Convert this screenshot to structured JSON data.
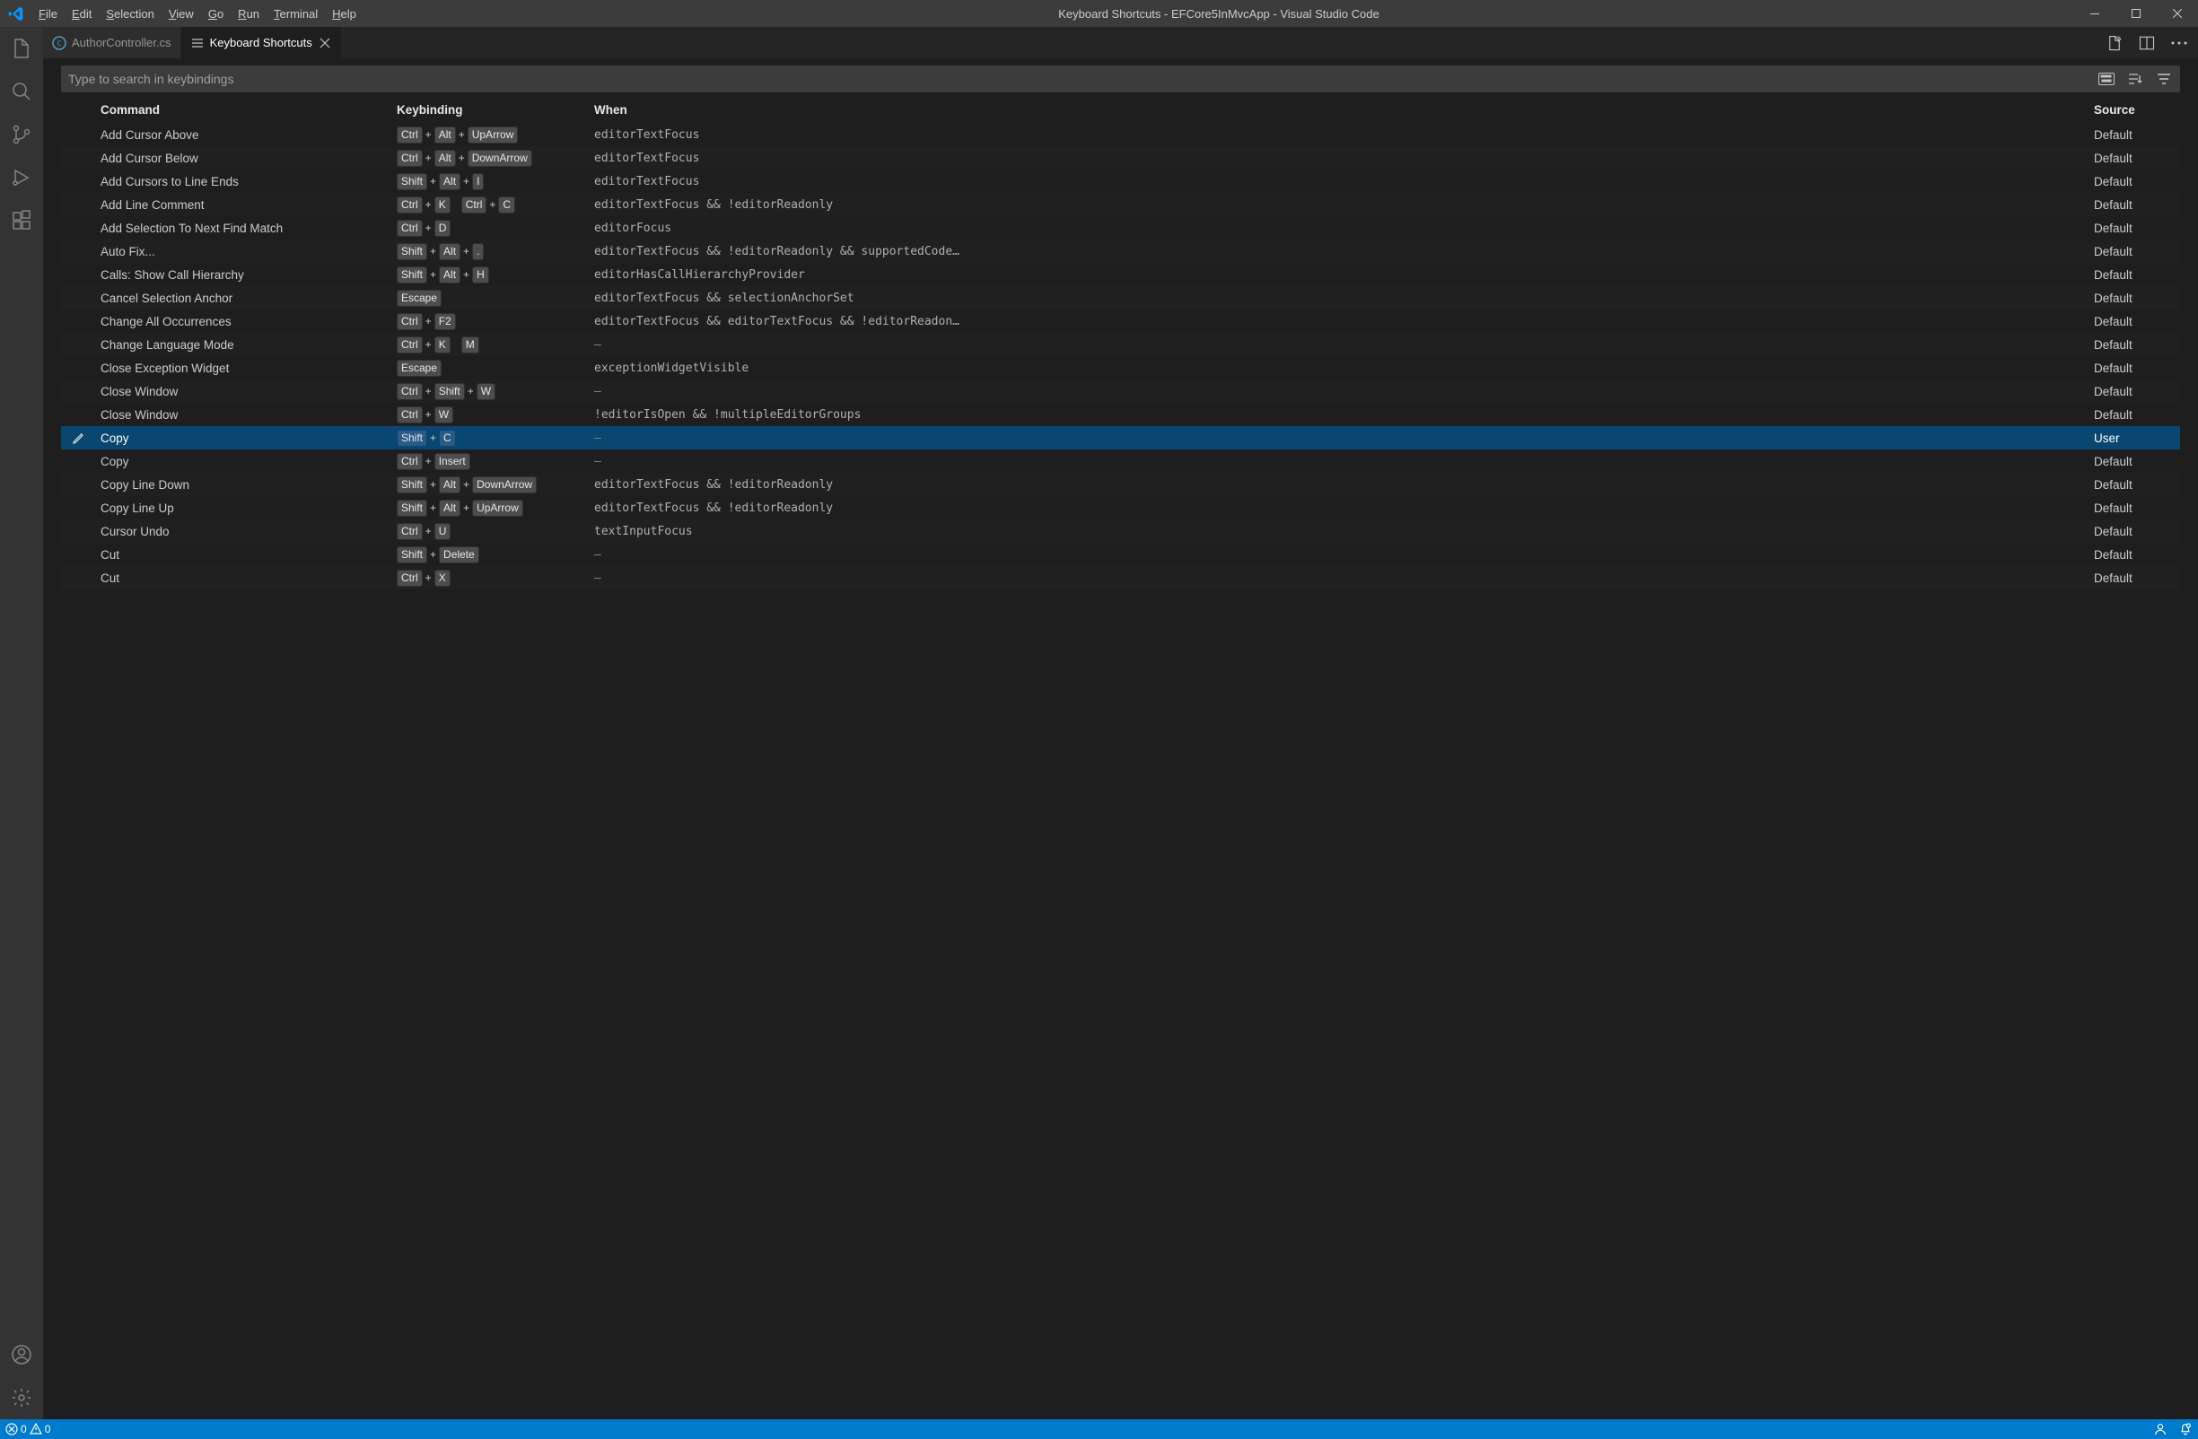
{
  "title": "Keyboard Shortcuts - EFCore5InMvcApp - Visual Studio Code",
  "menu": {
    "file": "File",
    "edit": "Edit",
    "selection": "Selection",
    "view": "View",
    "go": "Go",
    "run": "Run",
    "terminal": "Terminal",
    "help": "Help"
  },
  "tabs": {
    "inactive": {
      "label": "AuthorController.cs"
    },
    "active": {
      "label": "Keyboard Shortcuts"
    }
  },
  "search": {
    "placeholder": "Type to search in keybindings"
  },
  "headers": {
    "command": "Command",
    "keybinding": "Keybinding",
    "when": "When",
    "source": "Source"
  },
  "rows": [
    {
      "command": "Add Cursor Above",
      "keys": [
        "Ctrl",
        "+",
        "Alt",
        "+",
        "UpArrow"
      ],
      "when": "editorTextFocus",
      "source": "Default",
      "selected": false
    },
    {
      "command": "Add Cursor Below",
      "keys": [
        "Ctrl",
        "+",
        "Alt",
        "+",
        "DownArrow"
      ],
      "when": "editorTextFocus",
      "source": "Default",
      "selected": false
    },
    {
      "command": "Add Cursors to Line Ends",
      "keys": [
        "Shift",
        "+",
        "Alt",
        "+",
        "I"
      ],
      "when": "editorTextFocus",
      "source": "Default",
      "selected": false
    },
    {
      "command": "Add Line Comment",
      "keys": [
        "Ctrl",
        "+",
        "K",
        " ",
        "Ctrl",
        "+",
        "C"
      ],
      "when": "editorTextFocus && !editorReadonly",
      "source": "Default",
      "selected": false
    },
    {
      "command": "Add Selection To Next Find Match",
      "keys": [
        "Ctrl",
        "+",
        "D"
      ],
      "when": "editorFocus",
      "source": "Default",
      "selected": false
    },
    {
      "command": "Auto Fix...",
      "keys": [
        "Shift",
        "+",
        "Alt",
        "+",
        "."
      ],
      "when": "editorTextFocus && !editorReadonly && supportedCode…",
      "source": "Default",
      "selected": false
    },
    {
      "command": "Calls: Show Call Hierarchy",
      "keys": [
        "Shift",
        "+",
        "Alt",
        "+",
        "H"
      ],
      "when": "editorHasCallHierarchyProvider",
      "source": "Default",
      "selected": false
    },
    {
      "command": "Cancel Selection Anchor",
      "keys": [
        "Escape"
      ],
      "when": "editorTextFocus && selectionAnchorSet",
      "source": "Default",
      "selected": false
    },
    {
      "command": "Change All Occurrences",
      "keys": [
        "Ctrl",
        "+",
        "F2"
      ],
      "when": "editorTextFocus && editorTextFocus && !editorReadon…",
      "source": "Default",
      "selected": false
    },
    {
      "command": "Change Language Mode",
      "keys": [
        "Ctrl",
        "+",
        "K",
        " ",
        "M"
      ],
      "when": "—",
      "source": "Default",
      "selected": false
    },
    {
      "command": "Close Exception Widget",
      "keys": [
        "Escape"
      ],
      "when": "exceptionWidgetVisible",
      "source": "Default",
      "selected": false
    },
    {
      "command": "Close Window",
      "keys": [
        "Ctrl",
        "+",
        "Shift",
        "+",
        "W"
      ],
      "when": "—",
      "source": "Default",
      "selected": false
    },
    {
      "command": "Close Window",
      "keys": [
        "Ctrl",
        "+",
        "W"
      ],
      "when": "!editorIsOpen && !multipleEditorGroups",
      "source": "Default",
      "selected": false
    },
    {
      "command": "Copy",
      "keys": [
        "Shift",
        "+",
        "C"
      ],
      "when": "—",
      "source": "User",
      "selected": true
    },
    {
      "command": "Copy",
      "keys": [
        "Ctrl",
        "+",
        "Insert"
      ],
      "when": "—",
      "source": "Default",
      "selected": false
    },
    {
      "command": "Copy Line Down",
      "keys": [
        "Shift",
        "+",
        "Alt",
        "+",
        "DownArrow"
      ],
      "when": "editorTextFocus && !editorReadonly",
      "source": "Default",
      "selected": false
    },
    {
      "command": "Copy Line Up",
      "keys": [
        "Shift",
        "+",
        "Alt",
        "+",
        "UpArrow"
      ],
      "when": "editorTextFocus && !editorReadonly",
      "source": "Default",
      "selected": false
    },
    {
      "command": "Cursor Undo",
      "keys": [
        "Ctrl",
        "+",
        "U"
      ],
      "when": "textInputFocus",
      "source": "Default",
      "selected": false
    },
    {
      "command": "Cut",
      "keys": [
        "Shift",
        "+",
        "Delete"
      ],
      "when": "—",
      "source": "Default",
      "selected": false
    },
    {
      "command": "Cut",
      "keys": [
        "Ctrl",
        "+",
        "X"
      ],
      "when": "—",
      "source": "Default",
      "selected": false
    }
  ],
  "statusbar": {
    "errors": "0",
    "warnings": "0"
  }
}
